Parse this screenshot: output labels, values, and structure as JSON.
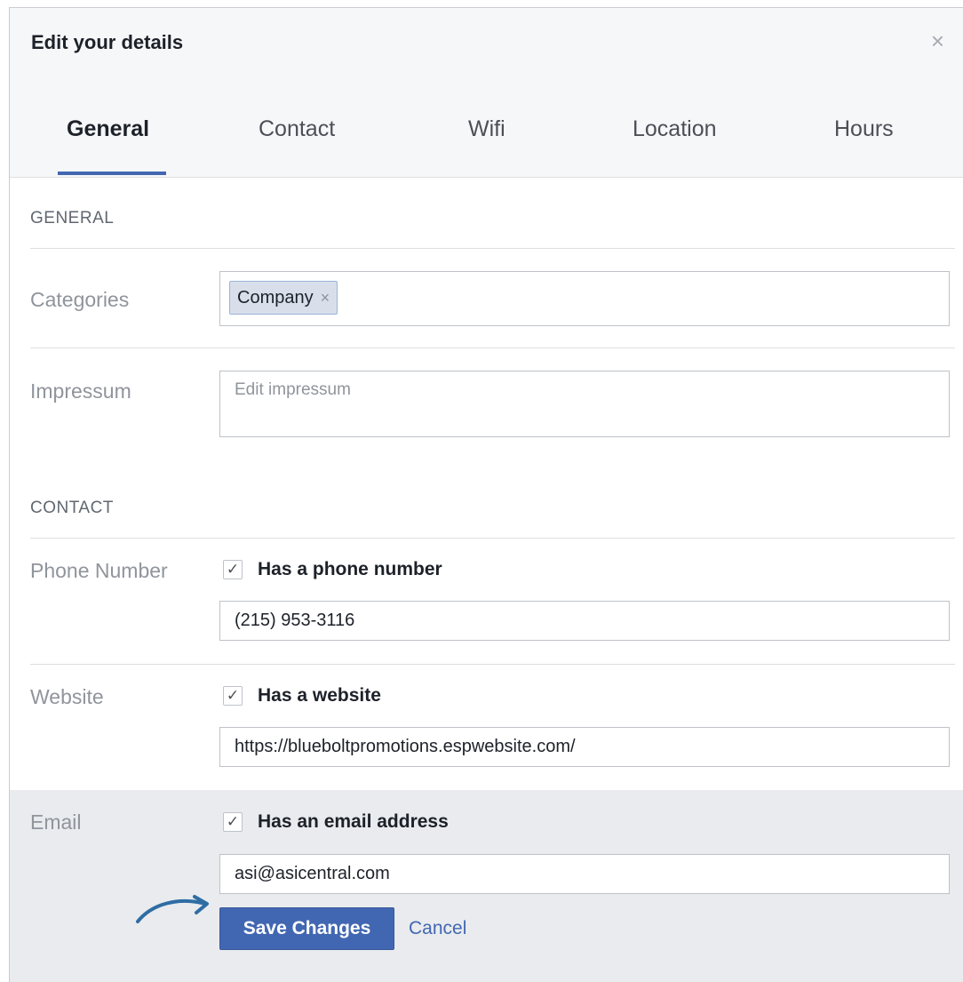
{
  "dialog": {
    "title": "Edit your details",
    "close_symbol": "×"
  },
  "tabs": [
    {
      "label": "General",
      "active": true
    },
    {
      "label": "Contact",
      "active": false
    },
    {
      "label": "Wifi",
      "active": false
    },
    {
      "label": "Location",
      "active": false
    },
    {
      "label": "Hours",
      "active": false
    }
  ],
  "general": {
    "heading": "GENERAL",
    "categories_label": "Categories",
    "category_token": "Company",
    "token_remove_symbol": "×",
    "impressum_label": "Impressum",
    "impressum_placeholder": "Edit impressum"
  },
  "contact": {
    "heading": "CONTACT",
    "phone": {
      "label": "Phone Number",
      "checkbox_label": "Has a phone number",
      "checked": true,
      "value": "(215) 953-3116"
    },
    "website": {
      "label": "Website",
      "checkbox_label": "Has a website",
      "checked": true,
      "value": "https://blueboltpromotions.espwebsite.com/"
    },
    "email": {
      "label": "Email",
      "checkbox_label": "Has an email address",
      "checked": true,
      "value": "asi@asicentral.com"
    }
  },
  "actions": {
    "save_label": "Save Changes",
    "cancel_label": "Cancel"
  },
  "check_symbol": "✓",
  "colors": {
    "accent": "#4267b2",
    "annotation_arrow": "#2e6da4"
  }
}
